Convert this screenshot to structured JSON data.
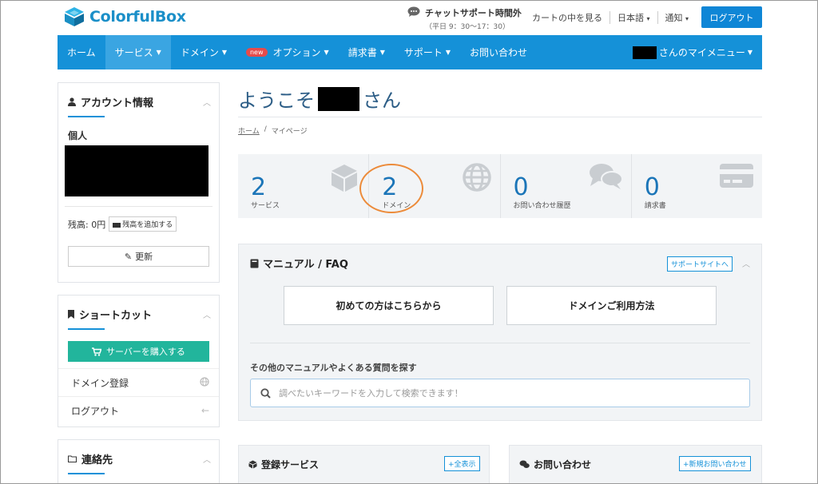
{
  "brand": {
    "name": "ColorfulBox"
  },
  "chat_support": {
    "title": "チャットサポート時間外",
    "hours": "（平日 9：30〜17：30）"
  },
  "top_links": {
    "cart": "カートの中を見る",
    "language": "日本語",
    "notify": "通知"
  },
  "logout_button": "ログアウト",
  "nav": {
    "items": [
      {
        "label": "ホーム"
      },
      {
        "label": "サービス"
      },
      {
        "label": "ドメイン"
      },
      {
        "label": "オプション",
        "badge": "new"
      },
      {
        "label": "請求書"
      },
      {
        "label": "サポート"
      },
      {
        "label": "お問い合わせ"
      }
    ],
    "user_menu": "さんのマイメニュー"
  },
  "account_panel": {
    "title": "アカウント情報",
    "type": "個人",
    "balance": "残高: 0円",
    "add_balance": "残高を追加する",
    "update": "更新"
  },
  "shortcut_panel": {
    "title": "ショートカット",
    "buy_server": "サーバーを購入する",
    "items": [
      {
        "label": "ドメイン登録",
        "icon": "globe-icon"
      },
      {
        "label": "ログアウト",
        "icon": "arrow-left-icon"
      }
    ]
  },
  "contact_panel": {
    "title": "連絡先"
  },
  "welcome": {
    "prefix": "ようこそ",
    "suffix": "さん"
  },
  "breadcrumb": {
    "home": "ホーム",
    "separator": "/",
    "current": "マイページ"
  },
  "stats": [
    {
      "value": "2",
      "label": "サービス",
      "icon": "cube-icon"
    },
    {
      "value": "2",
      "label": "ドメイン",
      "icon": "globe-icon"
    },
    {
      "value": "0",
      "label": "お問い合わせ履歴",
      "icon": "chat-bubbles-icon"
    },
    {
      "value": "0",
      "label": "請求書",
      "icon": "credit-card-icon"
    }
  ],
  "manual": {
    "title": "マニュアル / FAQ",
    "support_link": "サポートサイトへ",
    "button_beginner": "初めての方はこちらから",
    "button_domain": "ドメインご利用方法",
    "other_text": "その他のマニュアルやよくある質問を探す",
    "search_placeholder": "調べたいキーワードを入力して検索できます！"
  },
  "services_card": {
    "title": "登録サービス",
    "button": "全表示"
  },
  "inquiry_card": {
    "title": "お問い合わせ",
    "button": "新規お問い合わせ"
  },
  "colors": {
    "primary": "#1591d8",
    "accent_green": "#22b59c",
    "highlight_ring": "#ec8b3a",
    "stat_number": "#1b75b8"
  }
}
